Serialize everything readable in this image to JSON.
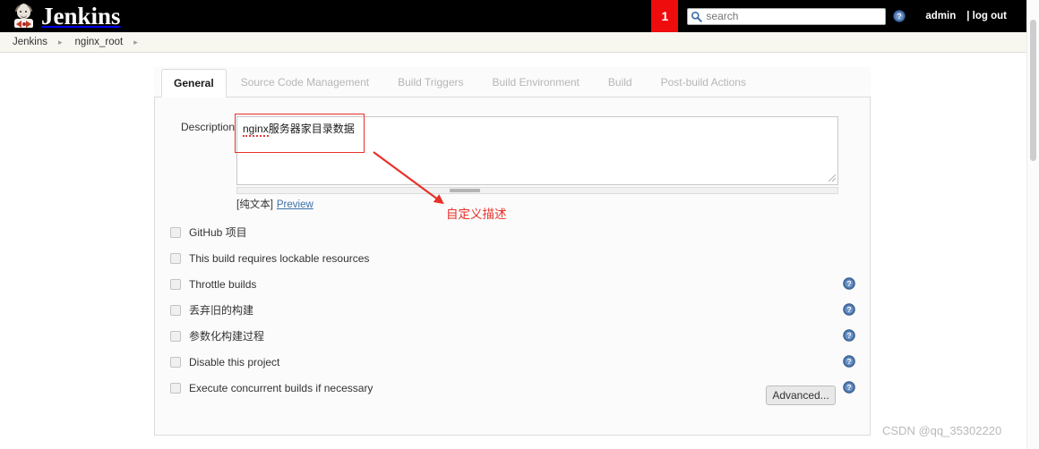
{
  "header": {
    "brand_name": "Jenkins",
    "logo_icon": "jenkins-butler-icon",
    "notification_count": "1",
    "search_placeholder": "search",
    "search_value": "",
    "search_icon": "search-icon",
    "help_icon": "help-icon",
    "user_label": "admin",
    "logout_label": "| log out",
    "background_color": "#000000",
    "badge_color": "#ef0c0c"
  },
  "breadcrumb": {
    "items": [
      {
        "label": "Jenkins",
        "separator": "▸"
      },
      {
        "label": "nginx_root",
        "separator": "▸"
      }
    ]
  },
  "tabs": [
    {
      "label": "General",
      "active": true
    },
    {
      "label": "Source Code Management",
      "active": false
    },
    {
      "label": "Build Triggers",
      "active": false
    },
    {
      "label": "Build Environment",
      "active": false
    },
    {
      "label": "Build",
      "active": false
    },
    {
      "label": "Post-build Actions",
      "active": false
    }
  ],
  "description": {
    "label": "Description",
    "value": "nginx服务器家目录数据",
    "misspelled_token": "nginx",
    "rest_text": "服务器家目录数据",
    "format_label": "[纯文本]",
    "preview_label": "Preview",
    "resize_grip_icon": "resize-grip-icon",
    "scrollbar_icon": "horizontal-scrollbar"
  },
  "annotation": {
    "text": "自定义描述",
    "color": "#e8312a",
    "arrow_icon": "arrow-icon",
    "box_icon": "highlight-box"
  },
  "options": [
    {
      "label": "GitHub 项目",
      "checked": false,
      "has_help": false
    },
    {
      "label": "This build requires lockable resources",
      "checked": false,
      "has_help": false
    },
    {
      "label": "Throttle builds",
      "checked": false,
      "has_help": true
    },
    {
      "label": "丢弃旧的构建",
      "checked": false,
      "has_help": true
    },
    {
      "label": "参数化构建过程",
      "checked": false,
      "has_help": true
    },
    {
      "label": "Disable this project",
      "checked": false,
      "has_help": true
    },
    {
      "label": "Execute concurrent builds if necessary",
      "checked": false,
      "has_help": true
    }
  ],
  "advanced": {
    "label": "Advanced..."
  },
  "watermark": {
    "text": "CSDN @qq_35302220"
  }
}
